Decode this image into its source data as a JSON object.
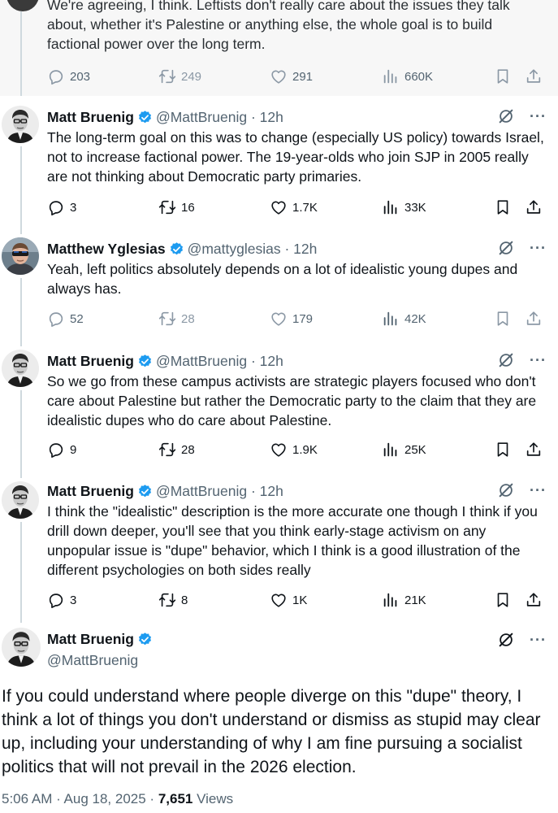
{
  "top_tweet": {
    "text": "We're agreeing, I think. Leftists don't really care about the issues they talk about, whether it's Palestine or anything else, the whole goal is to build factional power over the long term.",
    "replies": "203",
    "reposts": "249",
    "likes": "291",
    "views": "660K"
  },
  "replies": [
    {
      "name": "Matt Bruenig",
      "handle": "@MattBruenig",
      "time": "· 12h",
      "text": "The long-term goal on this was to change (especially US policy) towards Israel, not to increase factional power. The 19-year-olds who join SJP in 2005 really are not thinking about Democratic party primaries.",
      "replies": "3",
      "reposts": "16",
      "likes": "1.7K",
      "views": "33K"
    },
    {
      "name": "Matthew Yglesias",
      "handle": "@mattyglesias",
      "time": "· 12h",
      "text": "Yeah, left politics absolutely depends on a lot of idealistic young dupes and always has.",
      "replies": "52",
      "reposts": "28",
      "likes": "179",
      "views": "42K"
    },
    {
      "name": "Matt Bruenig",
      "handle": "@MattBruenig",
      "time": "· 12h",
      "text": "So we go from these campus activists are strategic players focused who don't care about Palestine but rather the Democratic party to the claim that they are idealistic dupes who do care about Palestine.",
      "replies": "9",
      "reposts": "28",
      "likes": "1.9K",
      "views": "25K"
    },
    {
      "name": "Matt Bruenig",
      "handle": "@MattBruenig",
      "time": "· 12h",
      "text": "I think the \"idealistic\" description is the more accurate one though I think if you drill down deeper, you'll see that you think early-stage activism on any unpopular issue is \"dupe\" behavior, which I think is a good illustration of the different psychologies on both sides really",
      "replies": "3",
      "reposts": "8",
      "likes": "1K",
      "views": "21K"
    }
  ],
  "main_tweet": {
    "name": "Matt Bruenig",
    "handle": "@MattBruenig",
    "text": "If you could understand where people diverge on this \"dupe\" theory, I think a lot of things you don't understand or dismiss as stupid may clear up, including your understanding of why I am fine pursuing a socialist politics that will not prevail in the 2026 election.",
    "timestamp": "5:06 AM · Aug 18, 2025 ·",
    "views_count": "7,651",
    "views_label": "Views"
  },
  "icons": [
    "reply-icon",
    "repost-icon",
    "like-icon",
    "views-icon",
    "bookmark-icon",
    "share-icon",
    "grok-icon",
    "more-icon",
    "verified-icon"
  ],
  "colors": {
    "verified": "#1d9bf0",
    "secondary_text": "#536471",
    "thread_line": "#cfd9de"
  }
}
